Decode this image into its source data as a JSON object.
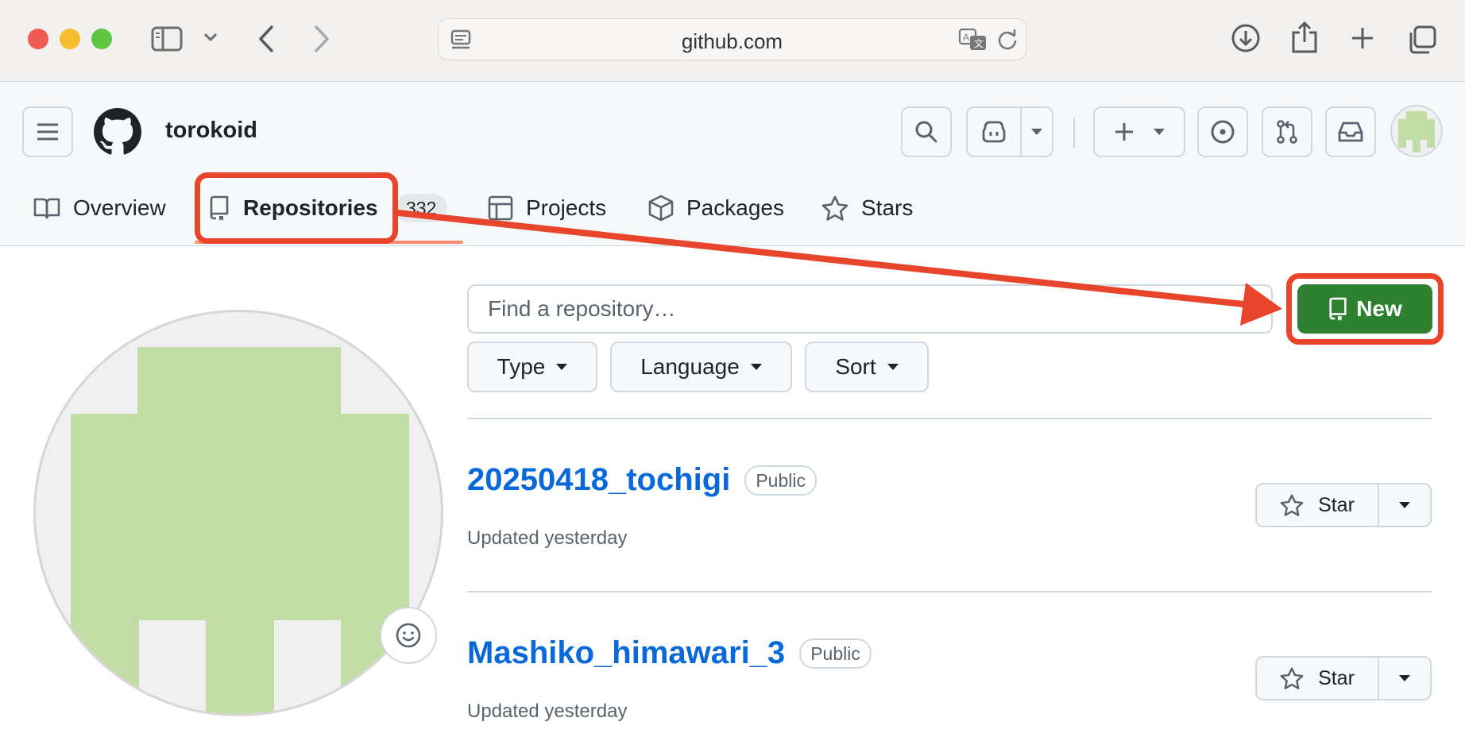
{
  "browser": {
    "url": "github.com",
    "colors": {
      "close": "#ee5a52",
      "minimize": "#f5bd2f",
      "zoom": "#5fc53f"
    }
  },
  "header": {
    "username": "torokoid"
  },
  "nav": {
    "tabs": [
      {
        "label": "Overview",
        "icon": "book-icon"
      },
      {
        "label": "Repositories",
        "icon": "repo-icon",
        "count": "332",
        "selected": true
      },
      {
        "label": "Projects",
        "icon": "table-icon"
      },
      {
        "label": "Packages",
        "icon": "package-icon"
      },
      {
        "label": "Stars",
        "icon": "star-icon"
      }
    ]
  },
  "main": {
    "search_placeholder": "Find a repository…",
    "filters": {
      "type": "Type",
      "language": "Language",
      "sort": "Sort"
    },
    "new_button": "New",
    "repos": [
      {
        "name": "20250418_tochigi",
        "visibility": "Public",
        "updated": "Updated yesterday",
        "star_label": "Star"
      },
      {
        "name": "Mashiko_himawari_3",
        "visibility": "Public",
        "updated": "Updated yesterday",
        "star_label": "Star"
      }
    ]
  },
  "colors": {
    "annotation_red": "#e8452c",
    "new_button_green": "#2f8132",
    "link_blue": "#0969da",
    "avatar_green": "#c1dca4"
  }
}
